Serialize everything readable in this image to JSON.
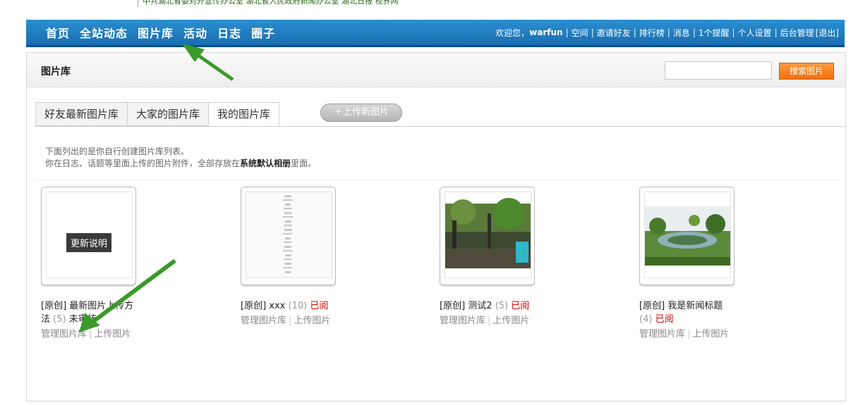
{
  "banner": {
    "text": "中共湖北省委对外宣传办公室 湖北省人民政府新闻办公室 湖北日报 视界网"
  },
  "nav": {
    "links": [
      "首页",
      "全站动态",
      "图片库",
      "活动",
      "日志",
      "圈子"
    ],
    "welcome": "欢迎您，",
    "username": "warfun",
    "user_links": [
      "空间",
      "邀请好友",
      "排行榜",
      "消息",
      "1个提醒",
      "个人设置",
      "后台管理",
      "[退出]"
    ]
  },
  "panel": {
    "title": "图片库",
    "search": {
      "placeholder": "",
      "button": "搜索图片"
    },
    "tabs": [
      "好友最新图片库",
      "大家的图片库",
      "我的图片库"
    ],
    "active_tab": "我的图片库",
    "upload_button": "＋上传新图片",
    "desc": {
      "line1": "下面列出的是你自行创建图片库列表。",
      "line2_pre": "你在日志、话题等里面上传的图片附件，全部存放在",
      "line2_bold": "系统默认相册",
      "line2_post": "里面。"
    }
  },
  "albums": [
    {
      "tag": "[原创]",
      "title": "最新图片上传方法",
      "count": "(5)",
      "status": "未审核",
      "status_color": "black",
      "thumb_text": "更新说明",
      "manage": "管理图片库",
      "upload": "上传图片"
    },
    {
      "tag": "[原创]",
      "title": "xxx",
      "count": "(10)",
      "status": "已阅",
      "status_color": "red",
      "thumb_text": "",
      "manage": "管理图片库",
      "upload": "上传图片"
    },
    {
      "tag": "[原创]",
      "title": "测试2",
      "count": "(5)",
      "status": "已阅",
      "status_color": "red",
      "thumb_text": "",
      "manage": "管理图片库",
      "upload": "上传图片"
    },
    {
      "tag": "[原创]",
      "title": "我是新闻标题",
      "count": "(4)",
      "status": "已阅",
      "status_color": "red",
      "thumb_text": "",
      "manage": "管理图片库",
      "upload": "上传图片"
    }
  ],
  "colors": {
    "nav_blue": "#1a6db0",
    "search_orange": "#f07010",
    "status_red": "#d40000",
    "arrow_green": "#3a9a2a"
  }
}
